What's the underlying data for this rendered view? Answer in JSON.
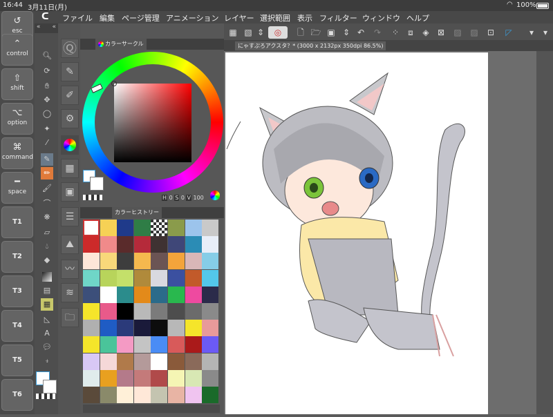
{
  "status": {
    "time": "16:44",
    "date": "3月11日(月)",
    "battery": "100%"
  },
  "modifiers": [
    {
      "sym": "↺",
      "label": "esc"
    },
    {
      "sym": "⌃",
      "label": "control"
    },
    {
      "sym": "⇧",
      "label": "shift"
    },
    {
      "sym": "⌥",
      "label": "option"
    },
    {
      "sym": "⌘",
      "label": "command"
    },
    {
      "sym": "━",
      "label": "space"
    },
    {
      "sym": "",
      "label": "T1"
    },
    {
      "sym": "",
      "label": "T2"
    },
    {
      "sym": "",
      "label": "T3"
    },
    {
      "sym": "",
      "label": "T4"
    },
    {
      "sym": "",
      "label": "T5"
    },
    {
      "sym": "",
      "label": "T6"
    }
  ],
  "menu": [
    "ファイル",
    "編集",
    "ページ管理",
    "アニメーション",
    "レイヤー",
    "選択範囲",
    "表示",
    "フィルター",
    "ウィンドウ",
    "ヘルプ"
  ],
  "panels": {
    "color_circle_tab": "カラーサークル",
    "history_tab": "カラーヒストリー",
    "hsv": {
      "h": "H",
      "h_val": "0",
      "s": "S",
      "s_val": "0",
      "v": "V",
      "v_val": "100"
    }
  },
  "canvas_tab": "にゃすぷろアクスタ？* (3000 x 2132px 350dpi 86.5%)",
  "colors": {
    "accent": "#3a9bd8",
    "swatch_rows": [
      [
        "#ffffff",
        "#f6d155",
        "#1f3a8a",
        "#2f7d46",
        "checker",
        "#8a9b4b",
        "#9cc4ec",
        "#c9c9c9"
      ],
      [
        "#cc2a2a",
        "#f08a8a",
        "#5a2b2b",
        "#b52a3a",
        "#3f3232",
        "#3f4778",
        "#2b8cb5",
        "#e8eef8"
      ],
      [
        "#fde6d8",
        "#f8d87a",
        "#3d3d3d",
        "#f5b84e",
        "#6b5454",
        "#f3a43b",
        "#d9b7b7",
        "#86cde7"
      ],
      [
        "#6fd6c8",
        "#b8d45b",
        "#c4e06a",
        "#b08a3b",
        "#d9d9e0",
        "#3b50a0",
        "#c25a2a",
        "#53c8ea"
      ],
      [
        "#3c4f7a",
        "#ffffff",
        "#2b8c8c",
        "#e38a1a",
        "#2b6b8a",
        "#29b84e",
        "#ee4aa0",
        "#2b2b4a"
      ],
      [
        "#f5e52a",
        "#e85a8a",
        "#000000",
        "#b9b9b9",
        "#7b7b7b",
        "#4d4d4d",
        "#6b6b6b",
        "#8a8a8a"
      ],
      [
        "#b0b0b0",
        "#1f5cc4",
        "#2b3a7a",
        "#1a1a3a",
        "#0d0d0d",
        "#b8b8b8",
        "#f5e52a",
        "#e89a9a"
      ],
      [
        "#f5e52a",
        "#4ac49a",
        "#f49ac4",
        "#c4c4c4",
        "#4a8cf5",
        "#d85a5a",
        "#aa1a1a",
        "#6b5af5"
      ],
      [
        "#d8c8f5",
        "#f5d8d8",
        "#b07a4a",
        "#b49a9a",
        "#ffffff",
        "#8a5a3a",
        "#8a6a5a",
        "#b4b4b4"
      ],
      [
        "#e0ecec",
        "#e8a020",
        "#b47a8a",
        "#c47a7a",
        "#b04a4a",
        "#f5f5b4",
        "#d8e8b4",
        "#8a8a8a"
      ],
      [
        "#5a4a3a",
        "#8a8a6a",
        "#fff0d8",
        "#ffe8d8",
        "#c4c4b0",
        "#e8b4a4",
        "#f0c4f0",
        "#1a6a2a"
      ]
    ]
  }
}
